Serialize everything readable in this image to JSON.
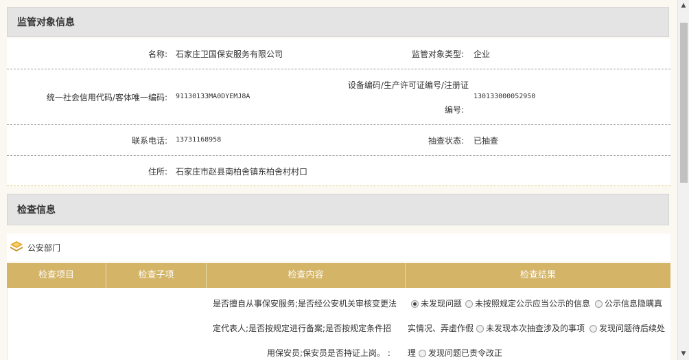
{
  "supervised": {
    "title": "监管对象信息",
    "name_label": "名称:",
    "name_value": "石家庄卫国保安服务有限公司",
    "type_label": "监管对象类型:",
    "type_value": "企业",
    "credit_label": "统一社会信用代码/客体唯一编码:",
    "credit_value": "91130133MA0DYEMJ8A",
    "device_label_line1": "设备编码/生产许可证编号/注册证",
    "device_label_line2": "编号:",
    "device_value": "130133000052950",
    "phone_label": "联系电话:",
    "phone_value": "13731168958",
    "status_label": "抽查状态:",
    "status_value": "已抽查",
    "address_label": "住所:",
    "address_value": "石家庄市赵县南柏舍镇东柏舍村村口"
  },
  "inspection": {
    "title": "检查信息",
    "department": "公安部门",
    "department_icon": "layers-icon",
    "headers": [
      "检查项目",
      "检查子项",
      "检查内容",
      "检查结果"
    ],
    "content_line1": "是否擅自从事保安服务;是否经公安机关审核变更法",
    "content_line2": "定代表人;是否按规定进行备案;是否按规定条件招",
    "content_line3": "用保安员;保安员是否持证上岗。  :",
    "result_options": [
      "未发现问题",
      "未按照规定公示应当公示的信息",
      "公示信息隐瞒真实情况、弄虚作假",
      "未发现本次抽查涉及的事项",
      "发现问题待后续处理",
      "发现问题已责令改正"
    ],
    "selected_option": "未发现问题",
    "wrap_frag_1": "实情况、弄虚作假",
    "wrap_frag_2": "理"
  },
  "colors": {
    "table_header": "#d4b467",
    "section_header": "#e4e4e4",
    "page_bg": "#fbf8f1"
  }
}
